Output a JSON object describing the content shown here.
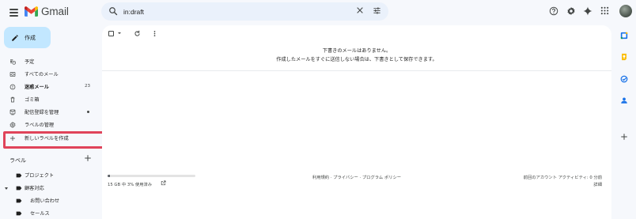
{
  "app": {
    "name": "Gmail"
  },
  "search": {
    "query": "in:draft"
  },
  "compose": {
    "label": "作成"
  },
  "nav": {
    "items": [
      {
        "label": "予定",
        "icon": "scheduled-icon",
        "bold": false,
        "count": ""
      },
      {
        "label": "すべてのメール",
        "icon": "all-mail-icon",
        "bold": false,
        "count": ""
      },
      {
        "label": "迷惑メール",
        "icon": "spam-icon",
        "bold": true,
        "count": "23"
      },
      {
        "label": "ゴミ箱",
        "icon": "trash-icon",
        "bold": false,
        "count": ""
      },
      {
        "label": "配信登録を管理",
        "icon": "manage-subscriptions-icon",
        "bold": false,
        "count": ""
      },
      {
        "label": "ラベルの管理",
        "icon": "settings-icon",
        "bold": false,
        "count": ""
      },
      {
        "label": "新しいラベルを作成",
        "icon": "plus-icon",
        "bold": false,
        "count": ""
      }
    ]
  },
  "labels": {
    "heading": "ラベル",
    "items": [
      {
        "label": "プロジェクト",
        "expanded": false
      },
      {
        "label": "顧客対応",
        "expanded": true
      },
      {
        "label": "お問い合わせ",
        "expanded": false
      },
      {
        "label": "セールス",
        "expanded": false
      }
    ]
  },
  "main": {
    "empty_title": "下書きのメールはありません。",
    "empty_desc": "作成したメールをすぐに送信しない場合は、下書きとして保存できます。",
    "storage_text": "15 GB 中 3% 使用済み",
    "storage_percent": 3,
    "footer_links": "利用規約 · プライバシー · プログラム ポリシー",
    "last_activity": "前回のアカウント アクティビティ: 0 分前",
    "details": "詳細"
  },
  "colors": {
    "compose_bg": "#c2e7ff",
    "search_bg": "#eaf1fb",
    "highlight": "#e0445a"
  }
}
